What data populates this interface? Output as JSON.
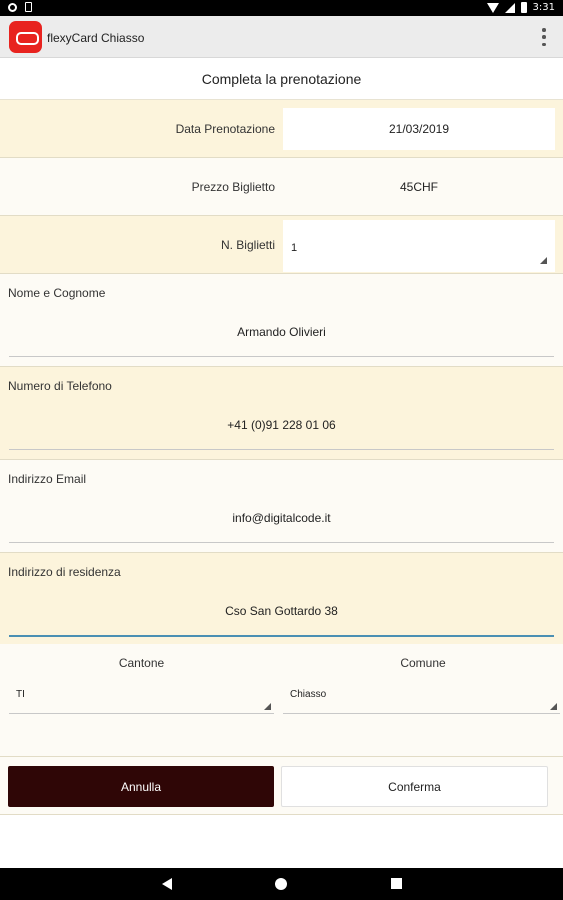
{
  "status_bar": {
    "time": "3:31"
  },
  "app_bar": {
    "title": "flexyCard Chiasso"
  },
  "page": {
    "title": "Completa la prenotazione"
  },
  "booking": {
    "date": {
      "label": "Data Prenotazione",
      "value": "21/03/2019"
    },
    "price": {
      "label": "Prezzo Biglietto",
      "value": "45CHF"
    },
    "tickets": {
      "label": "N. Biglietti",
      "value": "1"
    }
  },
  "form": {
    "name": {
      "label": "Nome e Cognome",
      "value": "Armando Olivieri"
    },
    "phone": {
      "label": "Numero di Telefono",
      "value": "+41 (0)91 228 01 06"
    },
    "email": {
      "label": "Indirizzo Email",
      "value": "info@digitalcode.it"
    },
    "address": {
      "label": "Indirizzo di residenza",
      "value": "Cso San Gottardo 38"
    }
  },
  "location": {
    "canton": {
      "label": "Cantone",
      "value": "TI"
    },
    "municipality": {
      "label": "Comune",
      "value": "Chiasso"
    }
  },
  "actions": {
    "cancel_label": "Annulla",
    "confirm_label": "Conferma"
  },
  "colors": {
    "row_alt": "#fcf4dc",
    "row_light": "#fdfbf5",
    "cancel_button": "#2f0606",
    "logo": "#e8231f",
    "active_underline": "#4a8fb3"
  },
  "icons": [
    "settings-icon",
    "sd-card-icon",
    "wifi-icon",
    "signal-icon",
    "battery-icon",
    "app-logo-icon",
    "overflow-menu-icon",
    "back-icon",
    "home-icon",
    "recents-icon"
  ]
}
